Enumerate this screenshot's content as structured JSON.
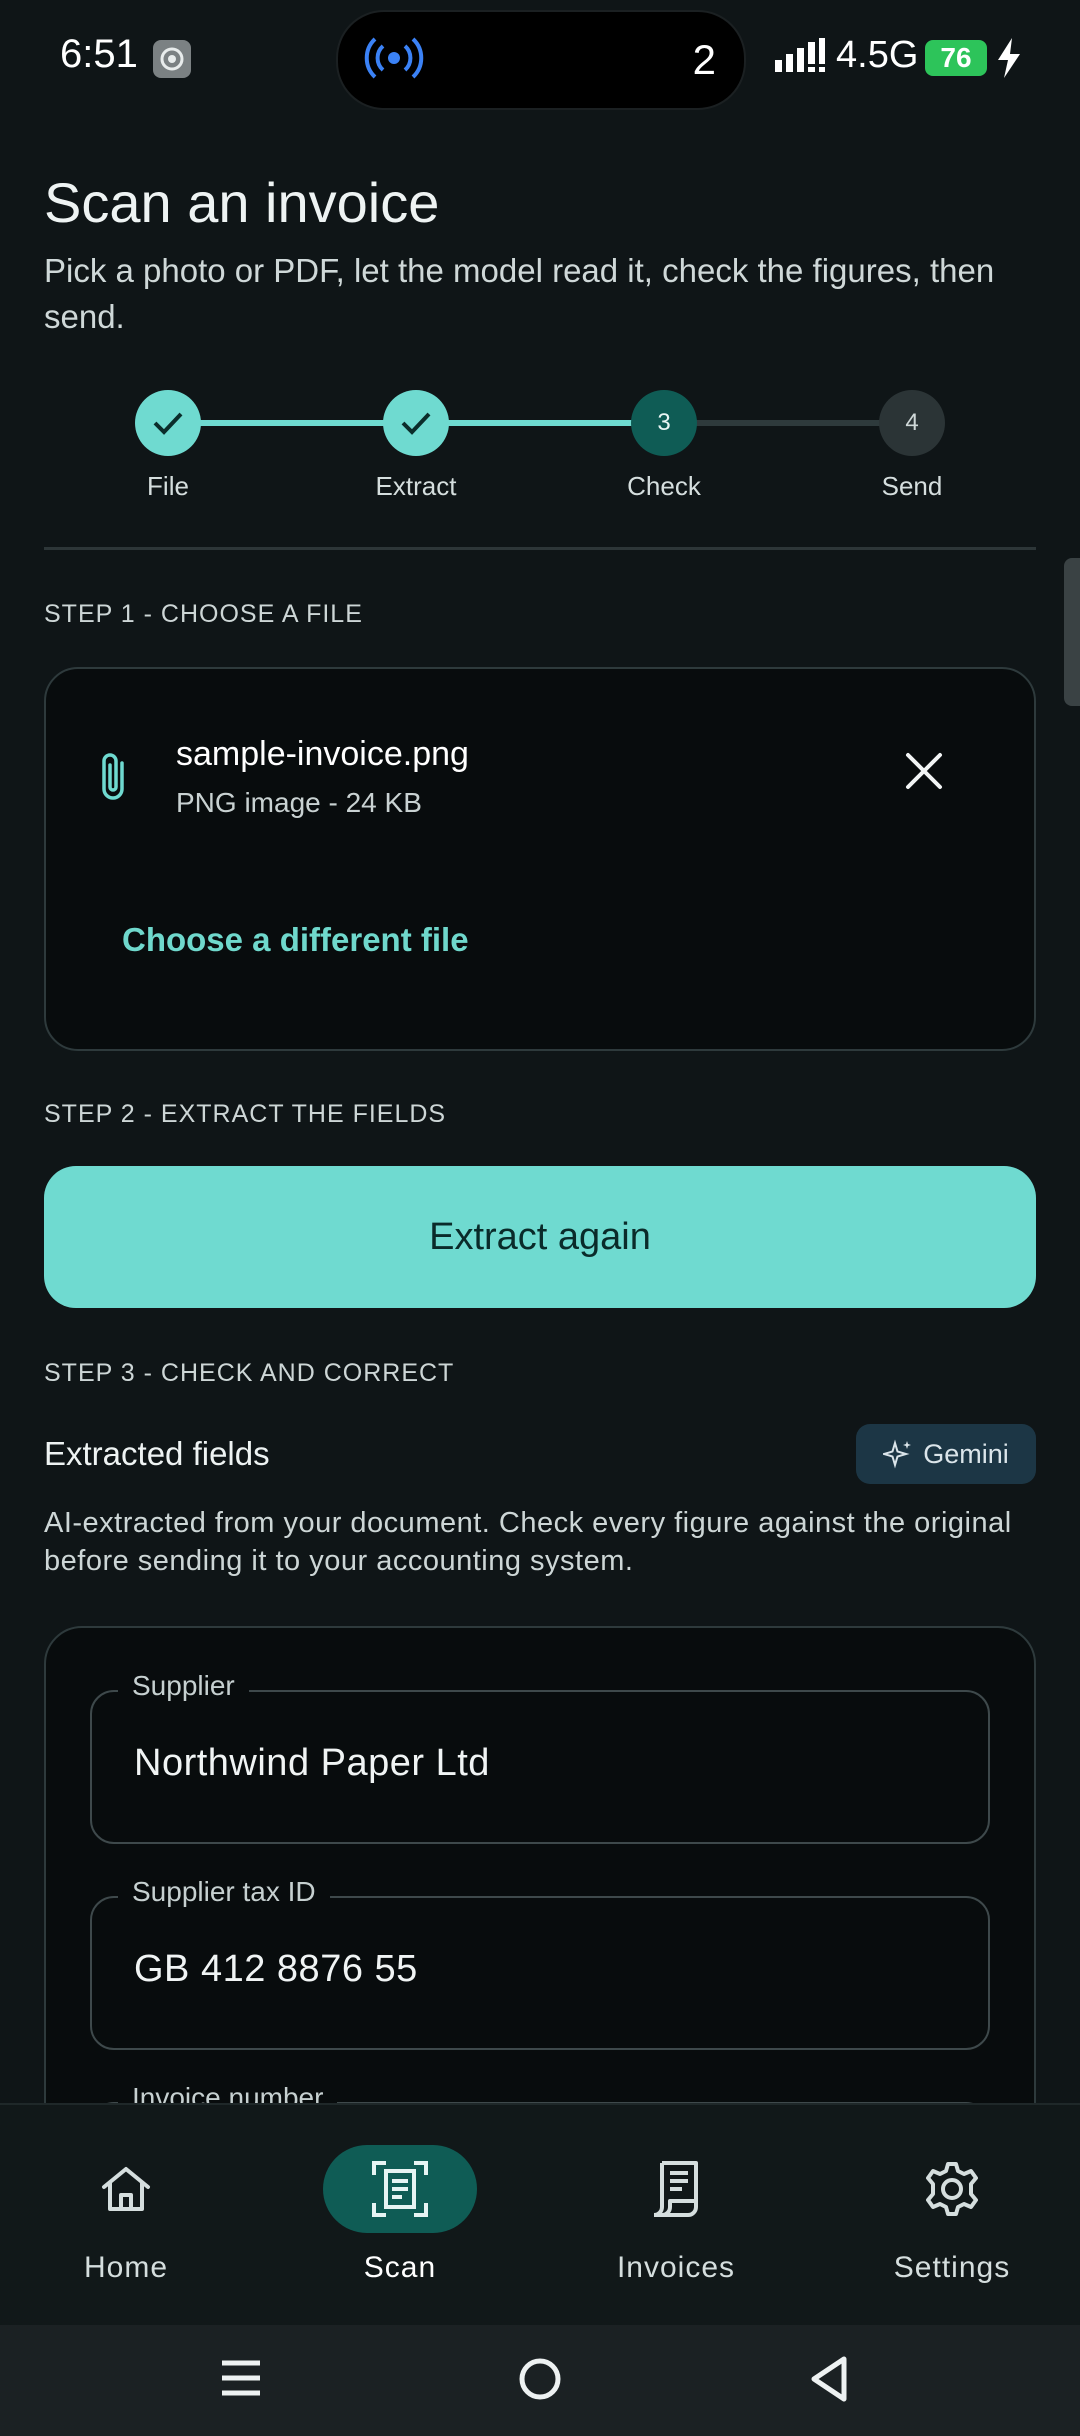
{
  "status_bar": {
    "time": "6:51",
    "island_count": "2",
    "network": "4.5G",
    "battery": "76"
  },
  "header": {
    "title": "Scan an invoice",
    "subtitle": "Pick a photo or PDF, let the model read it, check the figures, then send."
  },
  "stepper": [
    {
      "label": "File",
      "state": "done"
    },
    {
      "label": "Extract",
      "state": "done"
    },
    {
      "label": "Check",
      "number": "3",
      "state": "current"
    },
    {
      "label": "Send",
      "number": "4",
      "state": "pending"
    }
  ],
  "step1": {
    "heading": "STEP 1 - CHOOSE A FILE",
    "file_name": "sample-invoice.png",
    "file_meta": "PNG image - 24 KB",
    "choose_label": "Choose a different file"
  },
  "step2": {
    "heading": "STEP 2 - EXTRACT THE FIELDS",
    "button_label": "Extract again"
  },
  "step3": {
    "heading": "STEP 3 - CHECK AND CORRECT",
    "title": "Extracted fields",
    "chip_label": "Gemini",
    "description": "AI-extracted from your document. Check every figure against the original before sending it to your accounting system.",
    "fields": [
      {
        "label": "Supplier",
        "value": "Northwind Paper Ltd"
      },
      {
        "label": "Supplier tax ID",
        "value": "GB 412 8876 55"
      },
      {
        "label": "Invoice number",
        "value": ""
      }
    ]
  },
  "bottom_nav": [
    {
      "label": "Home",
      "icon": "home-icon"
    },
    {
      "label": "Scan",
      "icon": "scan-icon",
      "active": true
    },
    {
      "label": "Invoices",
      "icon": "receipt-icon"
    },
    {
      "label": "Settings",
      "icon": "gear-icon"
    }
  ],
  "colors": {
    "accent": "#6fdad0",
    "background": "#0f1517",
    "card": "#080c0d",
    "chip": "#1c3645"
  }
}
